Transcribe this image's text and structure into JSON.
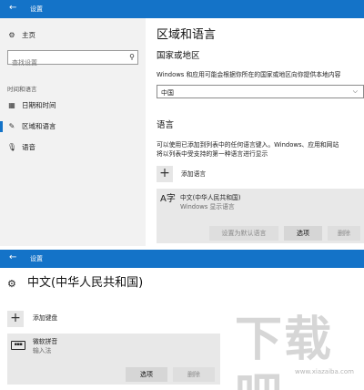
{
  "window1": {
    "title": "设置",
    "sidebar": {
      "home": "主页",
      "search_placeholder": "查找设置",
      "section": "时间和语言",
      "items": [
        {
          "label": "日期和时间",
          "icon": "calendar-clock-icon"
        },
        {
          "label": "区域和语言",
          "icon": "region-language-icon",
          "selected": true
        },
        {
          "label": "语音",
          "icon": "microphone-icon"
        }
      ]
    },
    "main": {
      "title": "区域和语言",
      "country_heading": "国家或地区",
      "country_desc": "Windows 和应用可能会根据你所在的国家或地区向你提供本地内容",
      "country_value": "中国",
      "language_heading": "语言",
      "language_desc_1": "可以使用已添加到列表中的任何语言键入。Windows、应用和网站",
      "language_desc_2": "将以列表中受支持的第一种语言进行显示",
      "add_language": "添加语言",
      "language_item": {
        "name": "中文(中华人民共和国)",
        "sub": "Windows 显示语言"
      },
      "buttons": {
        "set_default": "设置为默认语言",
        "options": "选项",
        "remove": "删除"
      }
    }
  },
  "window2": {
    "title": "设置",
    "page_title": "中文(中华人民共和国)",
    "add_keyboard": "添加键盘",
    "keyboard_item": {
      "name": "微软拼音",
      "sub": "输入法"
    },
    "buttons": {
      "options": "选项",
      "remove": "删除"
    }
  },
  "watermark": {
    "text": "下载吧",
    "url": "www.xiazaiba.com"
  },
  "colors": {
    "accent": "#1473c8",
    "sidebar_bg": "#f2f2f2",
    "panel_bg": "#e8e8e8"
  }
}
